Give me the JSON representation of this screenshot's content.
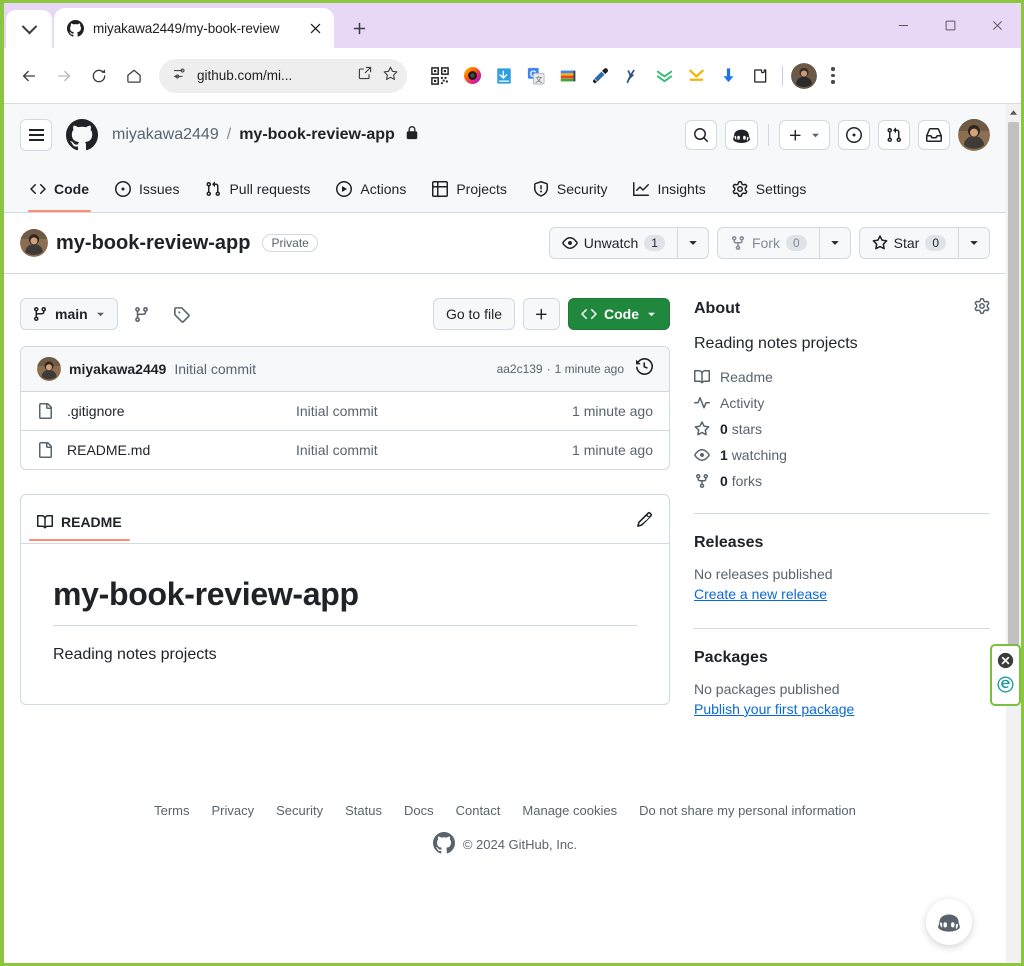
{
  "browser": {
    "tab": {
      "title": "miyakawa2449/my-book-review",
      "favicon": "github-icon"
    },
    "newtab_label": "+",
    "window_controls": {
      "minimize": "—",
      "maximize": "□",
      "close": "✕"
    },
    "omnibox": {
      "url_visible": "github.com/mi...",
      "url_host": "github.com",
      "url_path": "/mi..."
    },
    "extension_icons": [
      "qr-code-icon",
      "colorful-circle-icon",
      "download-blue-icon",
      "google-translate-icon",
      "colorful-bookmark-icon",
      "eyedropper-icon",
      "wave-tool-icon",
      "green-chevrons-icon",
      "yellow-collapse-icon",
      "blue-download-arrow-icon",
      "extensions-puzzle-icon"
    ]
  },
  "github": {
    "header": {
      "menu_icon": "hamburger-icon",
      "logo": "github-mark-icon",
      "owner": "miyakawa2449",
      "separator": "/",
      "repo": "my-book-review-app",
      "lock_icon": "lock-icon",
      "actions": [
        "search-icon",
        "copilot-icon",
        "plus-icon",
        "issues-icon",
        "pull-requests-icon",
        "inbox-icon"
      ]
    },
    "nav": [
      {
        "label": "Code",
        "icon": "code-icon",
        "active": true
      },
      {
        "label": "Issues",
        "icon": "issue-opened-icon",
        "active": false
      },
      {
        "label": "Pull requests",
        "icon": "git-pull-request-icon",
        "active": false
      },
      {
        "label": "Actions",
        "icon": "play-icon",
        "active": false
      },
      {
        "label": "Projects",
        "icon": "table-icon",
        "active": false
      },
      {
        "label": "Security",
        "icon": "shield-icon",
        "active": false
      },
      {
        "label": "Insights",
        "icon": "graph-icon",
        "active": false
      },
      {
        "label": "Settings",
        "icon": "gear-icon",
        "active": false
      }
    ],
    "repo_title": {
      "name": "my-book-review-app",
      "visibility": "Private",
      "watch": {
        "label": "Unwatch",
        "count": "1"
      },
      "fork": {
        "label": "Fork",
        "count": "0"
      },
      "star": {
        "label": "Star",
        "count": "0"
      }
    },
    "filebar": {
      "branch": "main",
      "branches_icon": "git-branch-icon",
      "tags_icon": "tag-icon",
      "go_to_file": "Go to file",
      "add_file": "+",
      "code_button": "Code"
    },
    "commit": {
      "author": "miyakawa2449",
      "message": "Initial commit",
      "sha": "aa2c139",
      "separator": "·",
      "time": "1 minute ago",
      "history_icon": "history-icon"
    },
    "files": [
      {
        "name": ".gitignore",
        "commit": "Initial commit",
        "time": "1 minute ago",
        "icon": "file-icon"
      },
      {
        "name": "README.md",
        "commit": "Initial commit",
        "time": "1 minute ago",
        "icon": "file-icon"
      }
    ],
    "readme": {
      "tab_label": "README",
      "book_icon": "book-icon",
      "edit_icon": "pencil-icon",
      "heading": "my-book-review-app",
      "paragraph": "Reading notes projects"
    },
    "about": {
      "title": "About",
      "gear_icon": "gear-icon",
      "description": "Reading notes projects",
      "items": [
        {
          "icon": "book-icon",
          "label": "Readme",
          "value": ""
        },
        {
          "icon": "pulse-icon",
          "label": "Activity",
          "value": ""
        },
        {
          "icon": "star-icon",
          "label": "stars",
          "value": "0"
        },
        {
          "icon": "eye-icon",
          "label": "watching",
          "value": "1"
        },
        {
          "icon": "fork-icon",
          "label": "forks",
          "value": "0"
        }
      ]
    },
    "releases": {
      "title": "Releases",
      "empty": "No releases published",
      "link": "Create a new release"
    },
    "packages": {
      "title": "Packages",
      "empty": "No packages published",
      "link": "Publish your first package"
    },
    "footer": {
      "links": [
        "Terms",
        "Privacy",
        "Security",
        "Status",
        "Docs",
        "Contact",
        "Manage cookies",
        "Do not share my personal information"
      ],
      "copyright": "© 2024 GitHub, Inc.",
      "logo": "github-mark-icon"
    },
    "copilot_fab": "copilot-icon"
  },
  "edge_widget": {
    "close_icon": "close-circle-icon",
    "edge_icon": "edge-logo-icon"
  },
  "colors": {
    "accent_green": "#1f883d",
    "link_blue": "#0969da",
    "underline_orange": "#fd8c73",
    "border": "#d1d9e0",
    "text": "#1f2328",
    "muted": "#59636e",
    "chrome_tabstrip": "#e9d7f7",
    "window_border_green": "#8cc63f"
  }
}
